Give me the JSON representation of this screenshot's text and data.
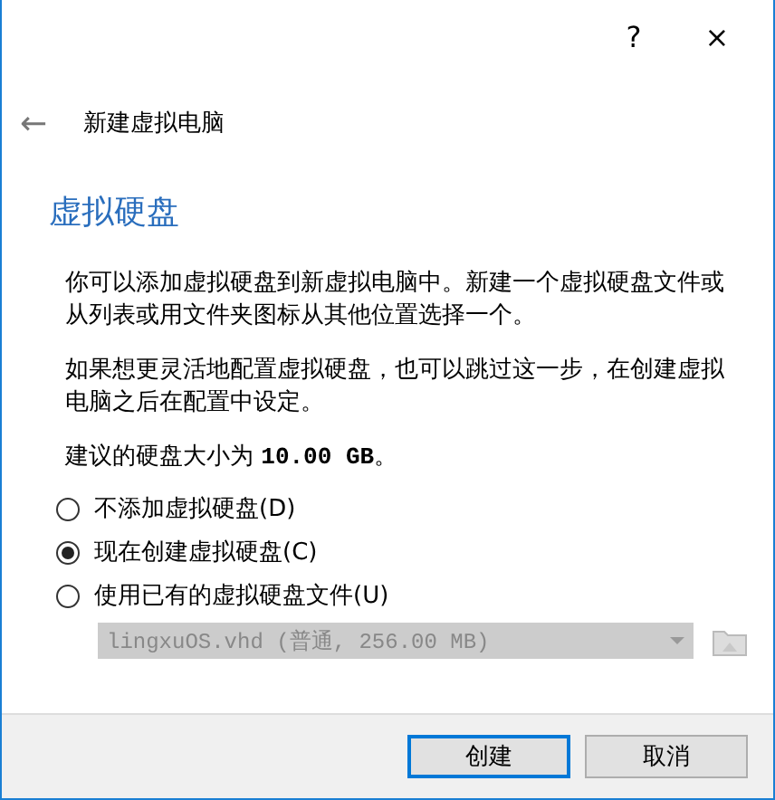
{
  "title_bar": {
    "help": "?",
    "close": "×"
  },
  "header": {
    "back": "←",
    "title": "新建虚拟电脑"
  },
  "heading": "虚拟硬盘",
  "paragraphs": [
    "你可以添加虚拟硬盘到新虚拟电脑中。新建一个虚拟硬盘文件或从列表或用文件夹图标从其他位置选择一个。",
    "如果想更灵活地配置虚拟硬盘，也可以跳过这一步，在创建虚拟电脑之后在配置中设定。",
    "建议的硬盘大小为 **10.00 GB**。"
  ],
  "options": [
    {
      "label": "不添加虚拟硬盘(D)",
      "selected": false
    },
    {
      "label": "现在创建虚拟硬盘(C)",
      "selected": true
    },
    {
      "label": "使用已有的虚拟硬盘文件(U)",
      "selected": false
    }
  ],
  "disk_select": {
    "value": "lingxuOS.vhd (普通, 256.00 MB)",
    "disabled": true
  },
  "buttons": [
    {
      "label": "创建",
      "focused": true
    },
    {
      "label": "取消",
      "focused": false
    }
  ]
}
